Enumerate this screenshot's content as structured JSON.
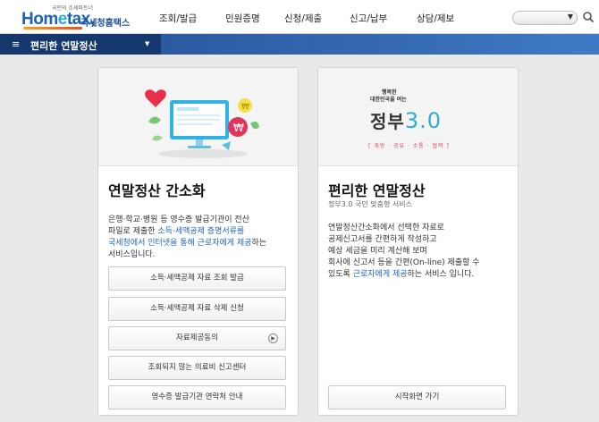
{
  "header": {
    "logo_tagline": "국민의 조세파트너",
    "logo_brand_a": "Hom",
    "logo_brand_e": "e",
    "logo_brand_b": "tax,",
    "logo_sub": "국세청홈택스",
    "nav": [
      "조회/발급",
      "민원증명",
      "신청/제출",
      "신고/납부",
      "상담/제보"
    ]
  },
  "subnav": {
    "title": "편리한 연말정산"
  },
  "left_card": {
    "title": "연말정산 간소화",
    "desc": [
      [
        {
          "t": "은행·학교·병원 등 영수증 발급기관이 전산",
          "h": false
        }
      ],
      [
        {
          "t": "파일로 제출한 ",
          "h": false
        },
        {
          "t": "소득·세액공제 증명서류를",
          "h": true
        }
      ],
      [
        {
          "t": "국세청에서 인터넷을 통해 근로자에게 제공",
          "h": true
        },
        {
          "t": "하는",
          "h": false
        }
      ],
      [
        {
          "t": "서비스입니다.",
          "h": false
        }
      ]
    ],
    "buttons": [
      "소득·세액공제 자료 조회 발급",
      "소득·세액공제 자료 삭제 신청",
      "자료제공동의",
      "조회되지 않는 의료비 신고센터",
      "영수증 발급기관 연락처 안내"
    ],
    "colors": {
      "monitor": "#2eb3e6",
      "heart": "#e8304a",
      "coin": "#e2345a",
      "leaf": "#7cc576"
    }
  },
  "right_card": {
    "gov_small1": "행복한",
    "gov_small2": "대한민국을 여는",
    "gov_main": "정부",
    "gov_num": "3.0",
    "gov_slogan": "[ 개방 · 공유 · 소통 · 협력 ]",
    "title": "편리한 연말정산",
    "subtitle": "정부3.0 국민 맞춤형 서비스",
    "desc": [
      [
        {
          "t": "연말정산간소화에서 선택한  자료로",
          "h": false
        }
      ],
      [
        {
          "t": "공제신고서를 간편하게 작성하고",
          "h": false
        }
      ],
      [
        {
          "t": "예상 세금을 미리 계산해 보며",
          "h": false
        }
      ],
      [
        {
          "t": "회사에 신고서 등을 간편(On-line) 제출할 수",
          "h": false
        }
      ],
      [
        {
          "t": "있도록 ",
          "h": false
        },
        {
          "t": "근로자에게 제공",
          "h": true
        },
        {
          "t": "하는 서비스 입니다.",
          "h": false
        }
      ]
    ],
    "start_button": "시작화면 가기"
  }
}
